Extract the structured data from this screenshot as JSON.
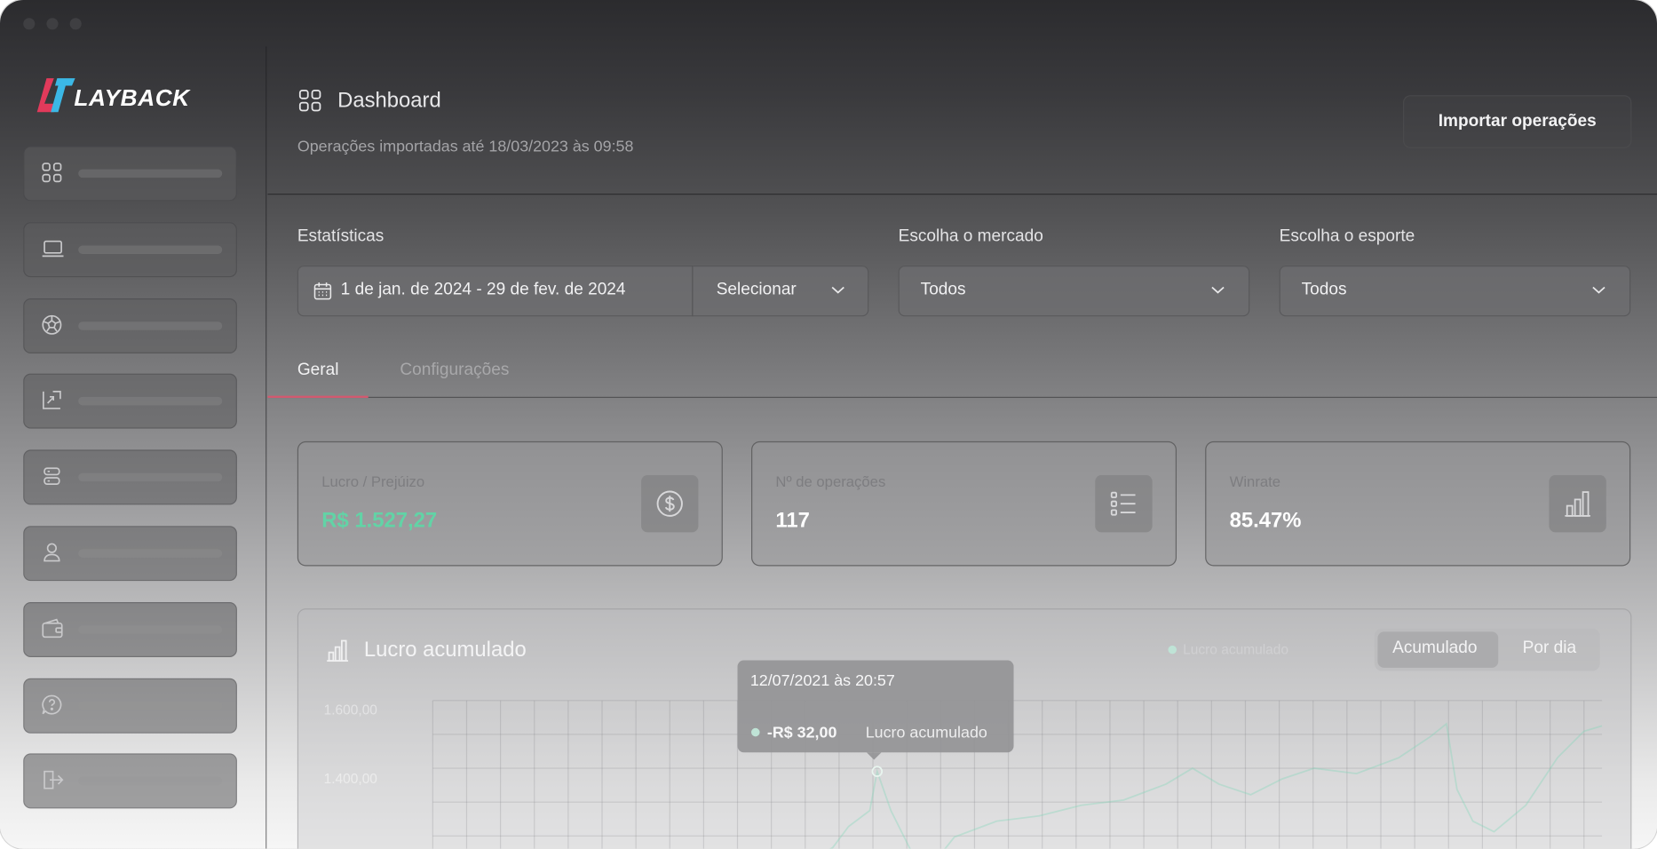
{
  "app": {
    "brand": "LAYBACK"
  },
  "header": {
    "title": "Dashboard",
    "subtitle": "Operações importadas até 18/03/2023 às 09:58",
    "import_button": "Importar operações"
  },
  "filters": {
    "statistics_label": "Estatísticas",
    "date_range": "1 de jan. de 2024 - 29 de fev. de 2024",
    "period_select": "Selecionar",
    "market_label": "Escolha o mercado",
    "market_value": "Todos",
    "sport_label": "Escolha o esporte",
    "sport_value": "Todos"
  },
  "tabs": [
    {
      "label": "Geral",
      "active": true
    },
    {
      "label": "Configurações",
      "active": false
    }
  ],
  "stats": [
    {
      "label": "Lucro / Prejúizo",
      "value": "R$ 1.527,27",
      "icon": "dollar-circle-icon",
      "color": "#62d3a6"
    },
    {
      "label": "Nº de operações",
      "value": "117",
      "icon": "list-icon",
      "color": "#ffffff"
    },
    {
      "label": "Winrate",
      "value": "85.47%",
      "icon": "bar-chart-icon",
      "color": "#ffffff"
    }
  ],
  "chart": {
    "title": "Lucro acumulado",
    "legend": "Lucro acumulado",
    "toggle": [
      "Acumulado",
      "Por dia"
    ],
    "active_toggle": "Acumulado",
    "y_ticks": [
      "1.600,00",
      "1.400,00"
    ],
    "line_color": "#7fd8b6",
    "tooltip": {
      "date": "12/07/2021 às 20:57",
      "value": "-R$ 32,00",
      "series": "Lucro acumulado"
    }
  },
  "sidebar": {
    "items": [
      {
        "icon": "grid-icon"
      },
      {
        "icon": "laptop-icon"
      },
      {
        "icon": "soccer-ball-icon"
      },
      {
        "icon": "trending-chart-icon"
      },
      {
        "icon": "server-icon"
      },
      {
        "icon": "user-icon"
      },
      {
        "icon": "wallet-icon"
      },
      {
        "icon": "help-icon"
      },
      {
        "icon": "logout-icon"
      }
    ]
  }
}
